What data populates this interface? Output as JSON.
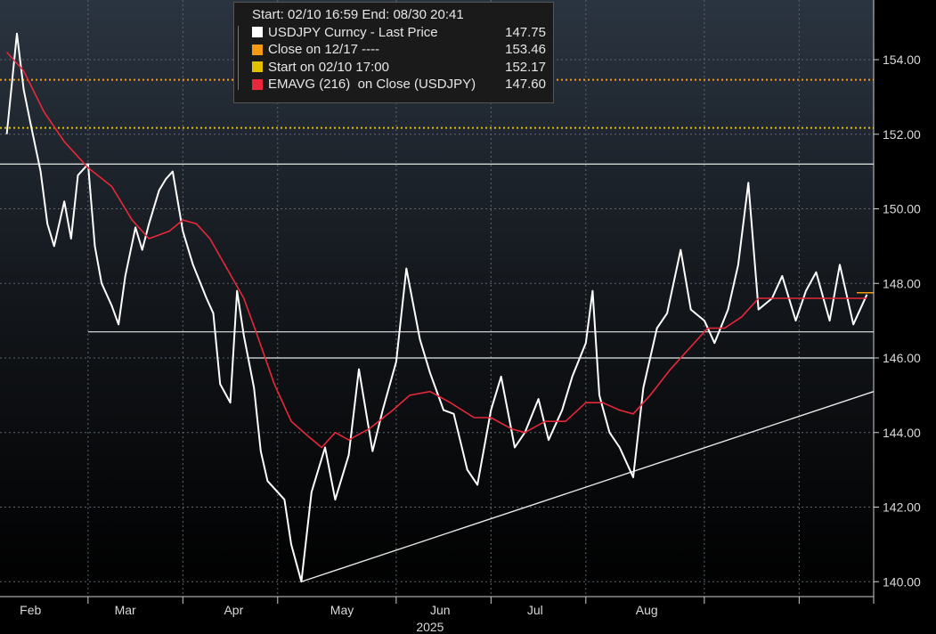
{
  "legend": {
    "header": "Start: 02/10 16:59 End: 08/30 20:41",
    "items": [
      {
        "label": "USDJPY Curncy - Last Price",
        "value": "147.75",
        "color": "#ffffff"
      },
      {
        "label": "Close on 12/17 ----",
        "value": "153.46",
        "color": "#f39c12"
      },
      {
        "label": "Start on 02/10 17:00",
        "value": "152.17",
        "color": "#e0c000"
      },
      {
        "label": "EMAVG (216)  on Close (USDJPY)",
        "value": "147.60",
        "color": "#e8283a"
      }
    ]
  },
  "chart_data": {
    "type": "line",
    "title": "",
    "xlabel": "2025",
    "ylabel": "",
    "ylim": [
      139.6,
      155.6
    ],
    "y_ticks": [
      "154.00",
      "152.00",
      "150.00",
      "148.00",
      "146.00",
      "144.00",
      "142.00",
      "140.00"
    ],
    "x_ticks": [
      "Feb",
      "Mar",
      "Apr",
      "May",
      "Jun",
      "Jul",
      "Aug"
    ],
    "grid": true,
    "legend_position": "top-left",
    "series": [
      {
        "name": "USDJPY Curncy - Last Price",
        "color": "#ffffff",
        "points": [
          [
            "2025-01-03",
            152.0
          ],
          [
            "2025-01-06",
            154.7
          ],
          [
            "2025-01-08",
            153.2
          ],
          [
            "2025-01-10",
            152.3
          ],
          [
            "2025-01-13",
            151.0
          ],
          [
            "2025-01-15",
            149.6
          ],
          [
            "2025-01-17",
            149.0
          ],
          [
            "2025-01-20",
            150.2
          ],
          [
            "2025-01-22",
            149.2
          ],
          [
            "2025-01-24",
            150.9
          ],
          [
            "2025-01-27",
            151.2
          ],
          [
            "2025-01-29",
            149.0
          ],
          [
            "2025-01-31",
            148.0
          ],
          [
            "2025-02-03",
            147.4
          ],
          [
            "2025-02-05",
            146.9
          ],
          [
            "2025-02-07",
            148.2
          ],
          [
            "2025-02-10",
            149.5
          ],
          [
            "2025-02-12",
            148.9
          ],
          [
            "2025-02-14",
            149.6
          ],
          [
            "2025-02-17",
            150.5
          ],
          [
            "2025-02-19",
            150.8
          ],
          [
            "2025-02-21",
            151.0
          ],
          [
            "2025-02-24",
            149.4
          ],
          [
            "2025-02-27",
            148.5
          ],
          [
            "2025-03-03",
            147.6
          ],
          [
            "2025-03-05",
            147.2
          ],
          [
            "2025-03-07",
            145.3
          ],
          [
            "2025-03-10",
            144.8
          ],
          [
            "2025-03-12",
            147.8
          ],
          [
            "2025-03-14",
            146.6
          ],
          [
            "2025-03-17",
            145.2
          ],
          [
            "2025-03-19",
            143.5
          ],
          [
            "2025-03-21",
            142.7
          ],
          [
            "2025-03-24",
            142.4
          ],
          [
            "2025-03-26",
            142.2
          ],
          [
            "2025-03-28",
            141.0
          ],
          [
            "2025-03-31",
            140.0
          ],
          [
            "2025-04-03",
            142.4
          ],
          [
            "2025-04-07",
            143.6
          ],
          [
            "2025-04-10",
            142.2
          ],
          [
            "2025-04-14",
            143.4
          ],
          [
            "2025-04-17",
            145.7
          ],
          [
            "2025-04-21",
            143.5
          ],
          [
            "2025-04-24",
            144.6
          ],
          [
            "2025-04-28",
            145.9
          ],
          [
            "2025-05-01",
            148.4
          ],
          [
            "2025-05-05",
            146.5
          ],
          [
            "2025-05-08",
            145.6
          ],
          [
            "2025-05-12",
            144.6
          ],
          [
            "2025-05-15",
            144.5
          ],
          [
            "2025-05-19",
            143.0
          ],
          [
            "2025-05-22",
            142.6
          ],
          [
            "2025-05-26",
            144.6
          ],
          [
            "2025-05-29",
            145.5
          ],
          [
            "2025-06-02",
            143.6
          ],
          [
            "2025-06-05",
            144.0
          ],
          [
            "2025-06-09",
            144.9
          ],
          [
            "2025-06-12",
            143.8
          ],
          [
            "2025-06-16",
            144.6
          ],
          [
            "2025-06-19",
            145.5
          ],
          [
            "2025-06-23",
            146.4
          ],
          [
            "2025-06-25",
            147.8
          ],
          [
            "2025-06-27",
            145.0
          ],
          [
            "2025-06-30",
            144.0
          ],
          [
            "2025-07-03",
            143.6
          ],
          [
            "2025-07-07",
            142.8
          ],
          [
            "2025-07-10",
            145.2
          ],
          [
            "2025-07-14",
            146.8
          ],
          [
            "2025-07-17",
            147.2
          ],
          [
            "2025-07-21",
            148.9
          ],
          [
            "2025-07-24",
            147.3
          ],
          [
            "2025-07-28",
            147.0
          ],
          [
            "2025-07-31",
            146.4
          ],
          [
            "2025-08-04",
            147.3
          ],
          [
            "2025-08-07",
            148.5
          ],
          [
            "2025-08-10",
            150.7
          ],
          [
            "2025-08-13",
            147.3
          ],
          [
            "2025-08-17",
            147.6
          ],
          [
            "2025-08-20",
            148.2
          ],
          [
            "2025-08-24",
            147.0
          ],
          [
            "2025-08-27",
            147.8
          ],
          [
            "2025-08-30",
            148.3
          ],
          [
            "2025-09-03",
            147.0
          ],
          [
            "2025-09-06",
            148.5
          ],
          [
            "2025-09-10",
            146.9
          ],
          [
            "2025-09-14",
            147.7
          ]
        ]
      },
      {
        "name": "EMAVG (216)  on Close (USDJPY)",
        "color": "#e8283a",
        "points": [
          [
            "2025-01-03",
            154.2
          ],
          [
            "2025-01-08",
            153.7
          ],
          [
            "2025-01-14",
            152.6
          ],
          [
            "2025-01-20",
            151.8
          ],
          [
            "2025-01-27",
            151.1
          ],
          [
            "2025-02-03",
            150.6
          ],
          [
            "2025-02-09",
            149.7
          ],
          [
            "2025-02-14",
            149.2
          ],
          [
            "2025-02-20",
            149.4
          ],
          [
            "2025-02-24",
            149.7
          ],
          [
            "2025-02-28",
            149.6
          ],
          [
            "2025-03-04",
            149.2
          ],
          [
            "2025-03-09",
            148.4
          ],
          [
            "2025-03-14",
            147.6
          ],
          [
            "2025-03-18",
            146.6
          ],
          [
            "2025-03-23",
            145.3
          ],
          [
            "2025-03-28",
            144.3
          ],
          [
            "2025-04-02",
            143.9
          ],
          [
            "2025-04-06",
            143.6
          ],
          [
            "2025-04-10",
            144.0
          ],
          [
            "2025-04-14",
            143.8
          ],
          [
            "2025-04-20",
            144.1
          ],
          [
            "2025-04-27",
            144.6
          ],
          [
            "2025-05-02",
            145.0
          ],
          [
            "2025-05-08",
            145.1
          ],
          [
            "2025-05-14",
            144.8
          ],
          [
            "2025-05-21",
            144.4
          ],
          [
            "2025-05-26",
            144.4
          ],
          [
            "2025-06-01",
            144.1
          ],
          [
            "2025-06-05",
            144.0
          ],
          [
            "2025-06-11",
            144.3
          ],
          [
            "2025-06-17",
            144.3
          ],
          [
            "2025-06-23",
            144.8
          ],
          [
            "2025-06-28",
            144.8
          ],
          [
            "2025-07-03",
            144.6
          ],
          [
            "2025-07-07",
            144.5
          ],
          [
            "2025-07-12",
            145.0
          ],
          [
            "2025-07-18",
            145.7
          ],
          [
            "2025-07-24",
            146.3
          ],
          [
            "2025-07-29",
            146.8
          ],
          [
            "2025-08-03",
            146.8
          ],
          [
            "2025-08-08",
            147.1
          ],
          [
            "2025-08-13",
            147.6
          ],
          [
            "2025-08-19",
            147.6
          ],
          [
            "2025-08-25",
            147.6
          ],
          [
            "2025-08-31",
            147.6
          ],
          [
            "2025-09-06",
            147.6
          ],
          [
            "2025-09-14",
            147.6
          ]
        ]
      }
    ],
    "reference_lines": [
      {
        "name": "Close on 12/17 ----",
        "value": 153.46,
        "color": "#f39c12"
      },
      {
        "name": "Start on 02/10 17:00",
        "value": 152.17,
        "color": "#e0c000"
      }
    ],
    "horizontal_lines": [
      {
        "value": 151.2,
        "from": "2025-01-01",
        "to": "2025-09-16"
      },
      {
        "value": 146.7,
        "from": "2025-01-27",
        "to": "2025-09-16"
      },
      {
        "value": 146.0,
        "from": "2025-03-15",
        "to": "2025-09-16"
      }
    ],
    "trendline": {
      "from": [
        "2025-03-31",
        140.0
      ],
      "to": [
        "2025-09-16",
        145.1
      ]
    },
    "last_price_marker": {
      "value": 147.75,
      "color": "#f39c12"
    }
  }
}
